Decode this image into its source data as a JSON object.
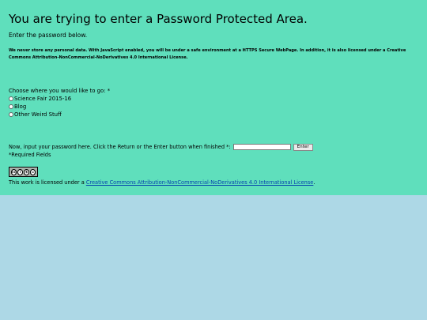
{
  "page": {
    "title": "You are trying to enter a Password Protected Area.",
    "subtitle": "Enter the password below.",
    "notice": "We never store any personal data. With JavaScript enabled, you will be under a safe environment at a HTTPS Secure WebPage. In addition, it is also licensed under a Creative Commons Attribution-NonCommercial-NoDerivatives 4.0 International License."
  },
  "destination": {
    "prompt": "Choose where you would like to go: *",
    "options": [
      {
        "label": "Science Fair 2015-16",
        "selected": false
      },
      {
        "label": "Blog",
        "selected": false
      },
      {
        "label": "Other Weird Stuff",
        "selected": false
      }
    ]
  },
  "password": {
    "prompt": "Now, input your password here. Click the Return or the Enter button when finished *:",
    "value": "",
    "button_label": "Enter",
    "required_note": "*Required Fields"
  },
  "license": {
    "badge_alt": "cc by-nc-nd",
    "prefix": "This work is licensed under a ",
    "link_text": "Creative Commons Attribution-NonCommercial-NoDerivatives 4.0 International License",
    "suffix": "."
  },
  "colors": {
    "panel": "#5fdfbc",
    "page": "#add8e6",
    "link": "#0645ad"
  }
}
